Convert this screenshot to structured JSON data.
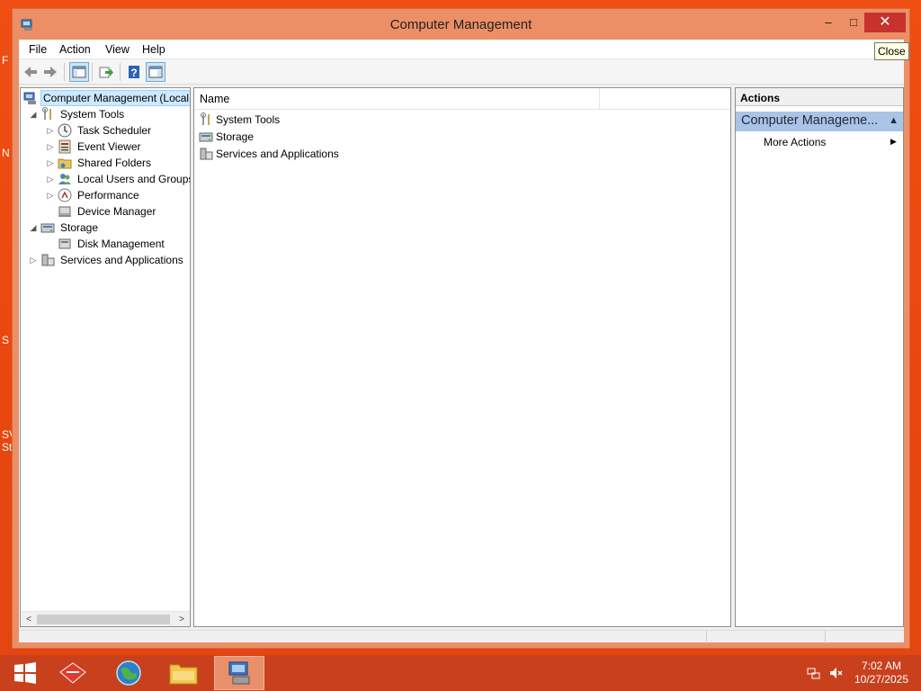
{
  "desktop": {
    "fragments": [
      "F",
      "N",
      "S",
      "SV",
      "St"
    ]
  },
  "window": {
    "title": "Computer Management",
    "controls": {
      "minimize": "–",
      "maximize": "□",
      "close": "✕"
    },
    "tooltip": "Close"
  },
  "menu": [
    "File",
    "Action",
    "View",
    "Help"
  ],
  "toolbar": {
    "buttons": [
      "back-icon",
      "forward-icon",
      "show-hide-console-tree-icon",
      "export-list-icon",
      "help-icon",
      "show-hide-action-pane-icon"
    ]
  },
  "tree": {
    "items": [
      {
        "label": "Computer Management (Local",
        "icon": "computer-management-icon",
        "expander": "",
        "selected": true
      },
      {
        "label": "System Tools",
        "icon": "system-tools-icon",
        "expander": "◢"
      },
      {
        "label": "Task Scheduler",
        "icon": "task-scheduler-icon",
        "expander": "▷"
      },
      {
        "label": "Event Viewer",
        "icon": "event-viewer-icon",
        "expander": "▷"
      },
      {
        "label": "Shared Folders",
        "icon": "shared-folders-icon",
        "expander": "▷"
      },
      {
        "label": "Local Users and Groups",
        "icon": "local-users-icon",
        "expander": "▷"
      },
      {
        "label": "Performance",
        "icon": "performance-icon",
        "expander": "▷"
      },
      {
        "label": "Device Manager",
        "icon": "device-manager-icon",
        "expander": ""
      },
      {
        "label": "Storage",
        "icon": "storage-icon",
        "expander": "◢"
      },
      {
        "label": "Disk Management",
        "icon": "disk-management-icon",
        "expander": ""
      },
      {
        "label": "Services and Applications",
        "icon": "services-apps-icon",
        "expander": "▷"
      }
    ],
    "scroll_left": "<",
    "scroll_right": ">"
  },
  "center": {
    "column_header": "Name",
    "items": [
      {
        "label": "System Tools",
        "icon": "system-tools-icon"
      },
      {
        "label": "Storage",
        "icon": "storage-icon"
      },
      {
        "label": "Services and Applications",
        "icon": "services-apps-icon"
      }
    ]
  },
  "actions": {
    "header": "Actions",
    "section_title": "Computer Manageme...",
    "collapse_glyph": "▲",
    "items": [
      {
        "label": "More Actions",
        "arrow": "▶"
      }
    ]
  },
  "taskbar": {
    "apps": [
      "windows-start-icon",
      "app-red-icon",
      "browser-globe-icon",
      "file-explorer-icon",
      "computer-management-task-icon"
    ],
    "tray": [
      "network-icon",
      "volume-muted-icon"
    ],
    "time": "7:02 AM",
    "date": "10/27/2025"
  },
  "colors": {
    "desktop": "#e8490f",
    "window_frame": "#ec8f66",
    "close_button": "#c7322d",
    "selection": "#cde8ff",
    "actions_section": "#aac3e6",
    "taskbar": "#c9401c"
  }
}
